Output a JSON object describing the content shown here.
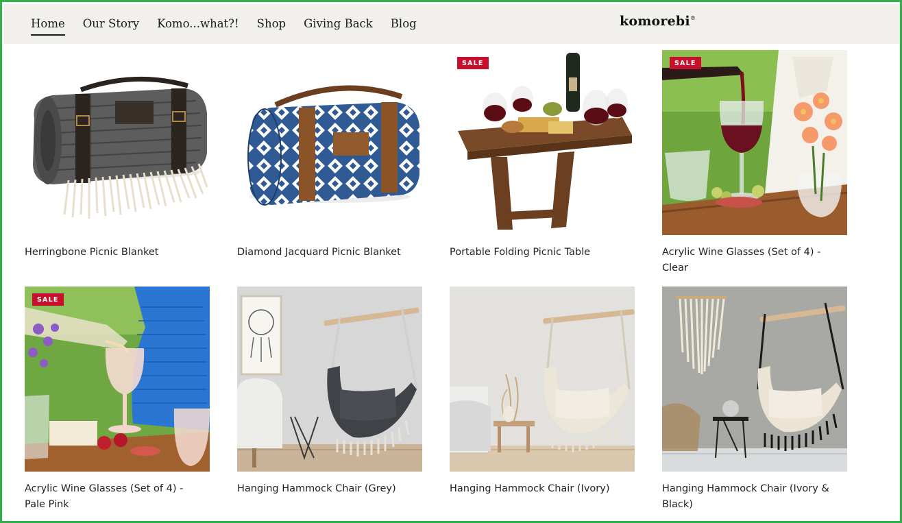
{
  "header": {
    "nav": [
      {
        "label": "Home",
        "active": true
      },
      {
        "label": "Our Story"
      },
      {
        "label": "Komo...what?!"
      },
      {
        "label": "Shop"
      },
      {
        "label": "Giving Back"
      },
      {
        "label": "Blog"
      }
    ],
    "logo_text": "komorebi",
    "logo_mark": "®"
  },
  "colors": {
    "frame": "#2fb04a",
    "header_bg": "#f1f0ec",
    "sale_badge": "#c8102e"
  },
  "products": [
    {
      "title": "Herringbone Picnic Blanket",
      "sale": false,
      "image": "grey-herringbone-rolled-blanket"
    },
    {
      "title": "Diamond Jacquard Picnic Blanket",
      "sale": false,
      "image": "blue-diamond-rolled-blanket"
    },
    {
      "title": "Portable Folding Picnic Table",
      "sale": true,
      "sale_label": "SALE",
      "image": "wooden-wine-table"
    },
    {
      "title": "Acrylic Wine Glasses (Set of 4) - Clear",
      "sale": true,
      "sale_label": "SALE",
      "image": "clear-wine-glasses-outdoor"
    },
    {
      "title": "Acrylic Wine Glasses (Set of 4) - Pale Pink",
      "sale": true,
      "sale_label": "SALE",
      "image": "pink-wine-glasses-outdoor"
    },
    {
      "title": "Hanging Hammock Chair (Grey)",
      "sale": false,
      "image": "grey-hammock-chair"
    },
    {
      "title": "Hanging Hammock Chair (Ivory)",
      "sale": false,
      "image": "ivory-hammock-chair"
    },
    {
      "title": "Hanging Hammock Chair (Ivory & Black)",
      "sale": false,
      "image": "ivory-black-hammock-chair"
    }
  ]
}
